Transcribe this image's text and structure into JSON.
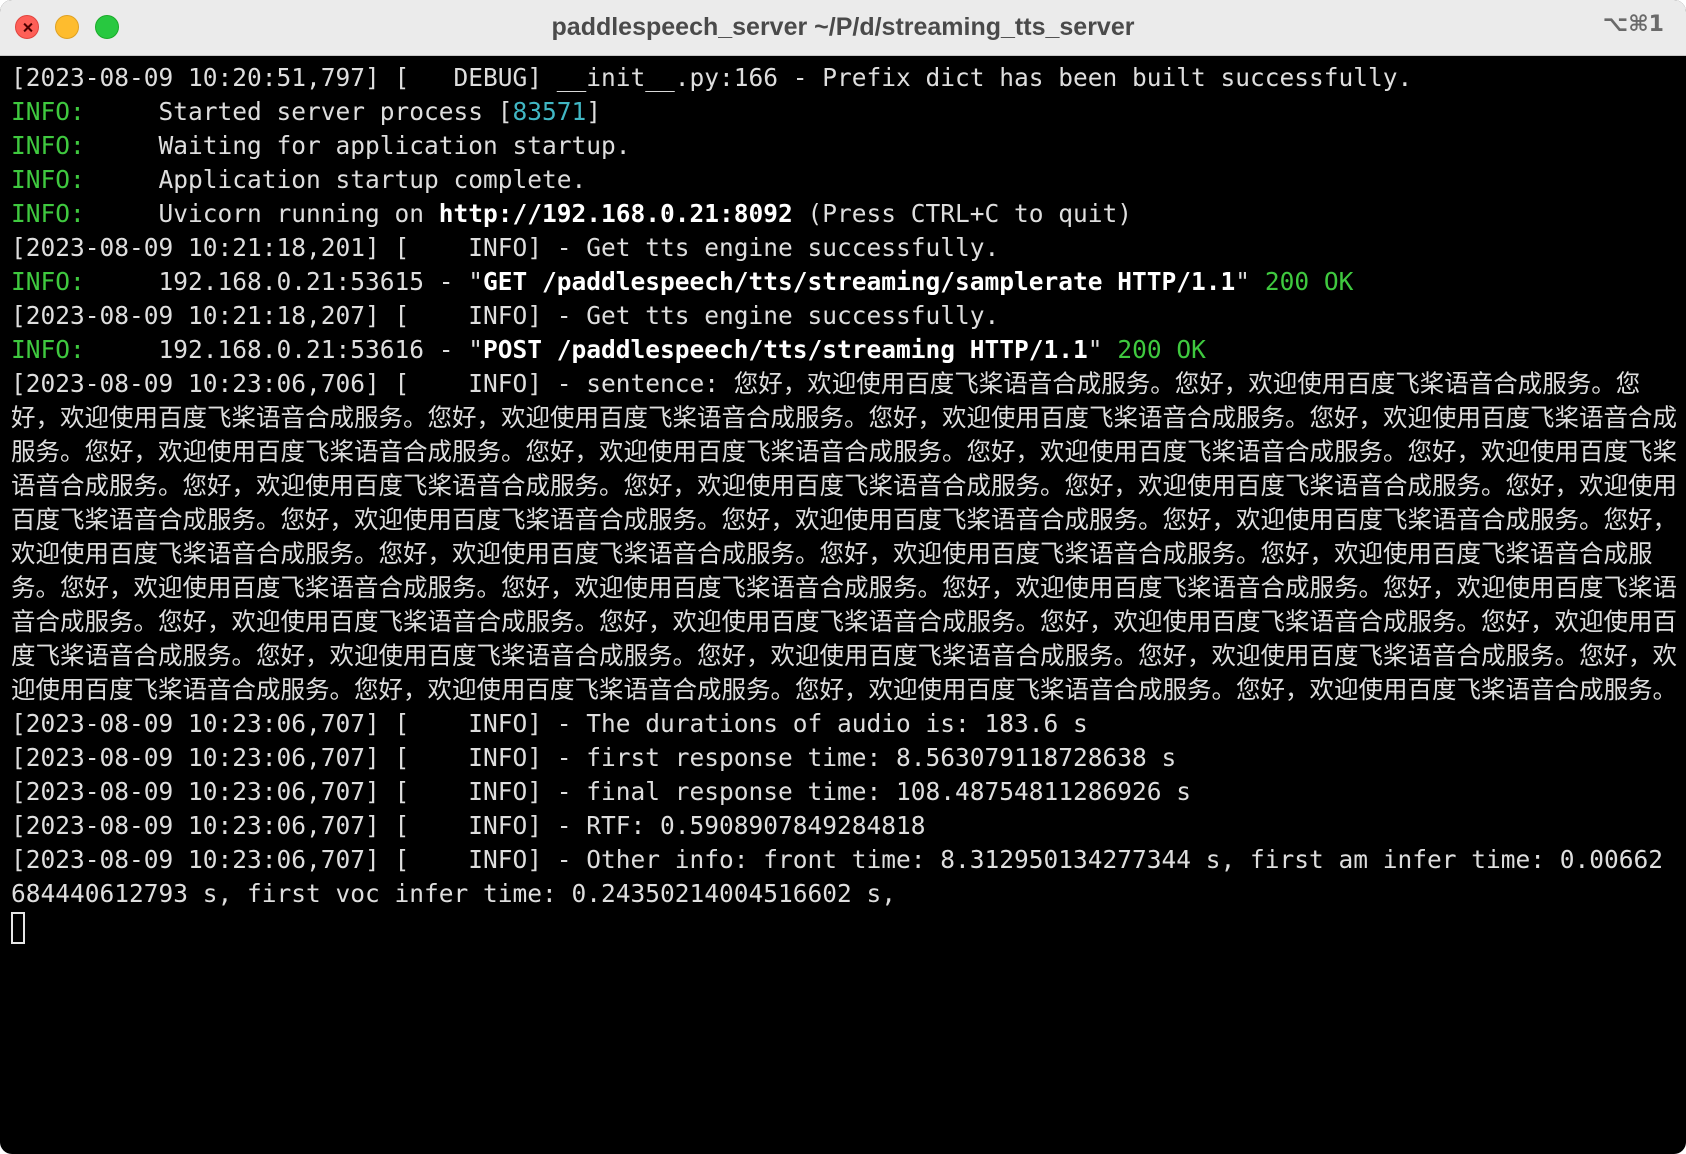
{
  "window": {
    "title": "paddlespeech_server  ~/P/d/streaming_tts_server",
    "shortcut": "⌥⌘1"
  },
  "log": {
    "l1": "[2023-08-09 10:20:51,797] [   DEBUG] __init__.py:166 - Prefix dict has been built successfully.",
    "info_tag": "INFO:",
    "l2_text": "     Started server process [",
    "l2_pid": "83571",
    "l2_end": "]",
    "l3_text": "     Waiting for application startup.",
    "l4_text": "     Application startup complete.",
    "l5_text": "     Uvicorn running on ",
    "l5_url": "http://192.168.0.21:8092",
    "l5_end": " (Press CTRL+C to quit)",
    "l6": "[2023-08-09 10:21:18,201] [    INFO] - Get tts engine successfully.",
    "l7_text": "     192.168.0.21:53615 - \"",
    "l7_req": "GET /paddlespeech/tts/streaming/samplerate HTTP/1.1",
    "l7_q": "\" ",
    "l7_status": "200 OK",
    "l8": "[2023-08-09 10:21:18,207] [    INFO] - Get tts engine successfully.",
    "l9_text": "     192.168.0.21:53616 - \"",
    "l9_req": "POST /paddlespeech/tts/streaming HTTP/1.1",
    "l9_q": "\" ",
    "l9_status": "200 OK",
    "sentence_prefix": "[2023-08-09 10:23:06,706] [    INFO] - sentence: ",
    "sentence_unit": "您好，欢迎使用百度飞桨语音合成服务。",
    "sentence_repeat": 36,
    "l11": "[2023-08-09 10:23:06,707] [    INFO] - The durations of audio is: 183.6 s",
    "l12": "[2023-08-09 10:23:06,707] [    INFO] - first response time: 8.563079118728638 s",
    "l13": "[2023-08-09 10:23:06,707] [    INFO] - final response time: 108.48754811286926 s",
    "l14": "[2023-08-09 10:23:06,707] [    INFO] - RTF: 0.5908907849284818",
    "l15a": "[2023-08-09 10:23:06,707] [    INFO] - Other info: front time: 8.312950134277344 s, first am infer time: 0.00662684440612793 s, first voc infer time: 0.24350214004516602 s,"
  },
  "colors": {
    "info_tag": "#3fc93f",
    "pid": "#41b7c4",
    "status_ok": "#3fc93f"
  }
}
